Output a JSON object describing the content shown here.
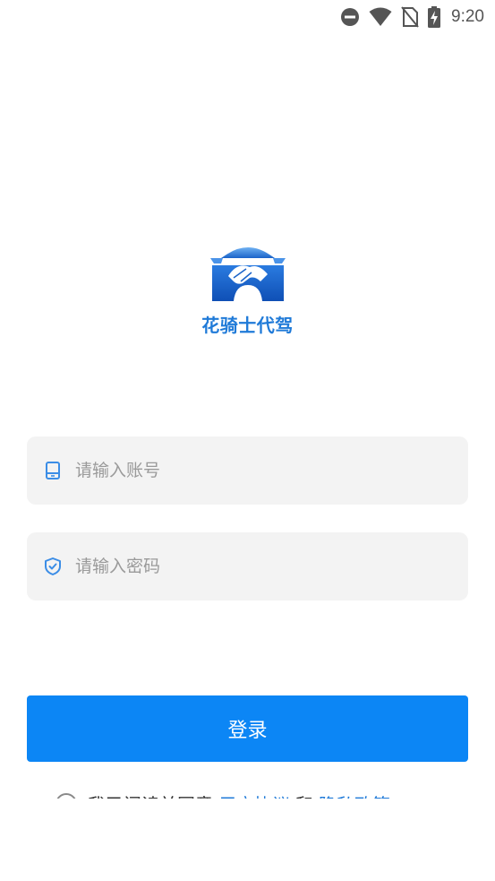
{
  "status_bar": {
    "time": "9:20",
    "icons": [
      "do-not-disturb-icon",
      "wifi-icon",
      "no-sim-icon",
      "battery-charging-icon"
    ]
  },
  "app": {
    "name": "花骑士代驾",
    "logo": "handshake-car-logo",
    "brand_color": "#1f7ad8"
  },
  "account_field": {
    "icon": "phone-icon",
    "placeholder": "请输入账号",
    "value": ""
  },
  "password_field": {
    "icon": "shield-check-icon",
    "placeholder": "请输入密码",
    "value": ""
  },
  "login_button": {
    "label": "登录",
    "color": "#0c86f5"
  },
  "agreement": {
    "prefix": "我已阅读并同意",
    "user_agreement": "用户协议",
    "and": "和",
    "privacy_policy": "隐私政策",
    "checked": false
  }
}
